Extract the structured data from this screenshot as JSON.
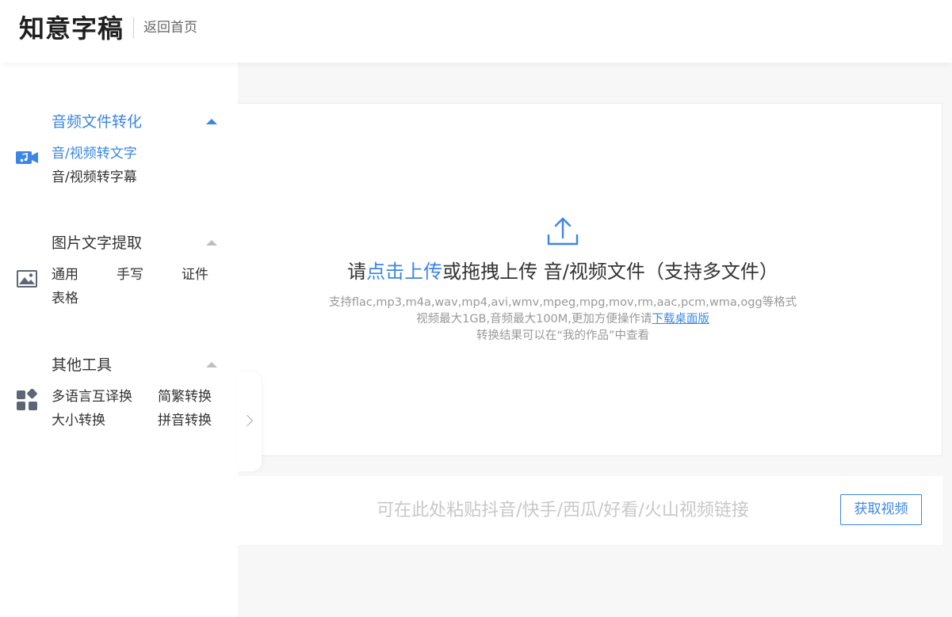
{
  "header": {
    "brand": "知意字稿",
    "back_home": "返回首页"
  },
  "sidebar": {
    "sections": [
      {
        "title": "音频文件转化",
        "icon": "video-camera-music-icon",
        "items": [
          "音/视频转文字",
          "音/视频转字幕"
        ]
      },
      {
        "title": "图片文字提取",
        "icon": "image-icon",
        "items": [
          "通用",
          "手写",
          "证件",
          "表格"
        ]
      },
      {
        "title": "其他工具",
        "icon": "apps-grid-icon",
        "items": [
          "多语言互译换",
          "简繁转换",
          "大小转换",
          "拼音转换"
        ]
      }
    ]
  },
  "upload": {
    "title_prefix": "请",
    "title_link": "点击上传",
    "title_suffix": "或拖拽上传 音/视频文件（支持多文件）",
    "formats": "支持flac,mp3,m4a,wav,mp4,avi,wmv,mpeg,mpg,mov,rm,aac,pcm,wma,ogg等格式",
    "limits_prefix": "视频最大1GB,音频最大100M,更加方便操作请",
    "limits_link": "下载桌面版",
    "result_note": "转换结果可以在“我的作品”中查看"
  },
  "link_bar": {
    "placeholder": "可在此处粘贴抖音/快手/西瓜/好看/火山视频链接",
    "value": "",
    "button": "获取视频"
  },
  "colors": {
    "accent": "#3b86e6",
    "text": "#333333",
    "muted": "#999999",
    "background": "#f7f7f8"
  }
}
